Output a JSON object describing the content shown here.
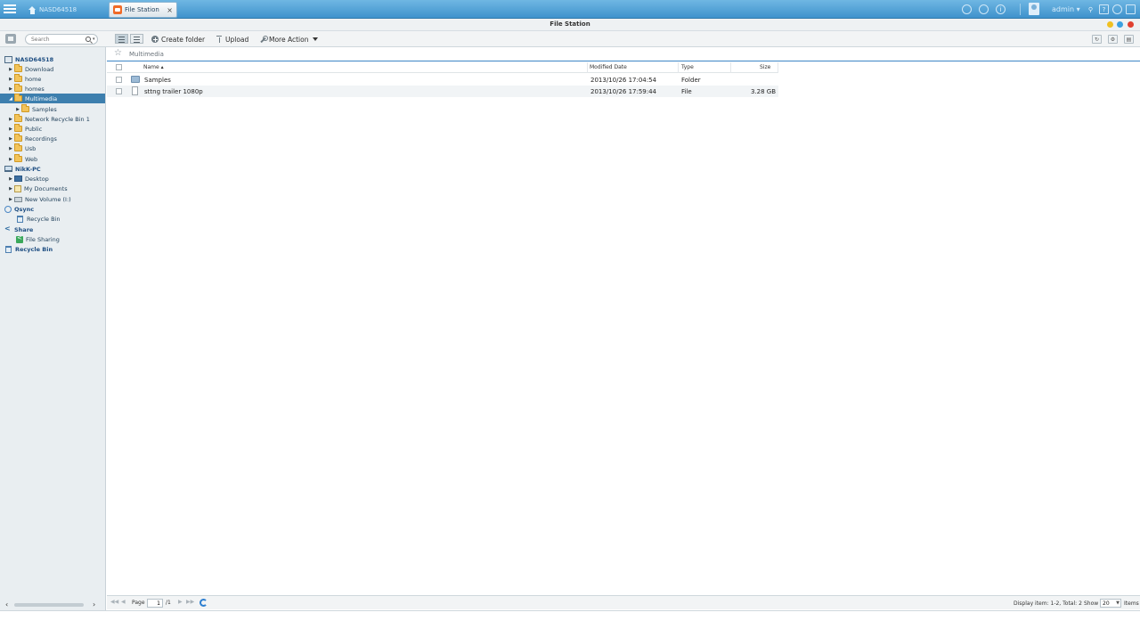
{
  "topbar": {
    "desktop_tab": "NASD64518",
    "app_tab": "File Station",
    "app_tab_close": "×",
    "user": "admin",
    "user_caret": "▾",
    "help_glyph": "?"
  },
  "window": {
    "title": "File Station"
  },
  "toolbar": {
    "search_placeholder": "Search",
    "search_caret": "▾",
    "create_folder": "Create folder",
    "upload": "Upload",
    "more_action": "More Action"
  },
  "sidebar": {
    "items": [
      {
        "label": "NASD64518",
        "kind": "nas"
      },
      {
        "label": "Download",
        "kind": "folder"
      },
      {
        "label": "home",
        "kind": "folder"
      },
      {
        "label": "homes",
        "kind": "folder"
      },
      {
        "label": "Multimedia",
        "kind": "folder",
        "selected": true
      },
      {
        "label": "Samples",
        "kind": "subfolder"
      },
      {
        "label": "Network Recycle Bin 1",
        "kind": "folder"
      },
      {
        "label": "Public",
        "kind": "folder"
      },
      {
        "label": "Recordings",
        "kind": "folder"
      },
      {
        "label": "Usb",
        "kind": "folder"
      },
      {
        "label": "Web",
        "kind": "folder"
      },
      {
        "label": "NikK-PC",
        "kind": "pc"
      },
      {
        "label": "Desktop",
        "kind": "desktop"
      },
      {
        "label": "My Documents",
        "kind": "documents"
      },
      {
        "label": "New Volume (I:)",
        "kind": "volume"
      },
      {
        "label": "Qsync",
        "kind": "qsync"
      },
      {
        "label": "Recycle Bin",
        "kind": "bin-child"
      },
      {
        "label": "Share",
        "kind": "share"
      },
      {
        "label": "File Sharing",
        "kind": "file-sharing"
      },
      {
        "label": "Recycle Bin",
        "kind": "bin-root"
      }
    ]
  },
  "path": {
    "current": "Multimedia"
  },
  "grid": {
    "columns": {
      "name": "Name ▴",
      "modified": "Modified Date",
      "type": "Type",
      "size": "Size"
    },
    "rows": [
      {
        "name": "Samples",
        "modified": "2013/10/26 17:04:54",
        "type": "Folder",
        "size": "",
        "icon": "folder"
      },
      {
        "name": "sttng trailer 1080p",
        "modified": "2013/10/26 17:59:44",
        "type": "File",
        "size": "3.28 GB",
        "icon": "file"
      }
    ]
  },
  "status": {
    "page_label": "Page",
    "page_value": "1",
    "page_total": "/1",
    "display": "Display item: 1-2, Total: 2",
    "show_label": "Show",
    "show_value": "20",
    "items_label": "Items"
  },
  "colors": {
    "topbar": "#4a9bd3",
    "selected_row": "#3d7fae",
    "app_icon": "#f06a27"
  }
}
